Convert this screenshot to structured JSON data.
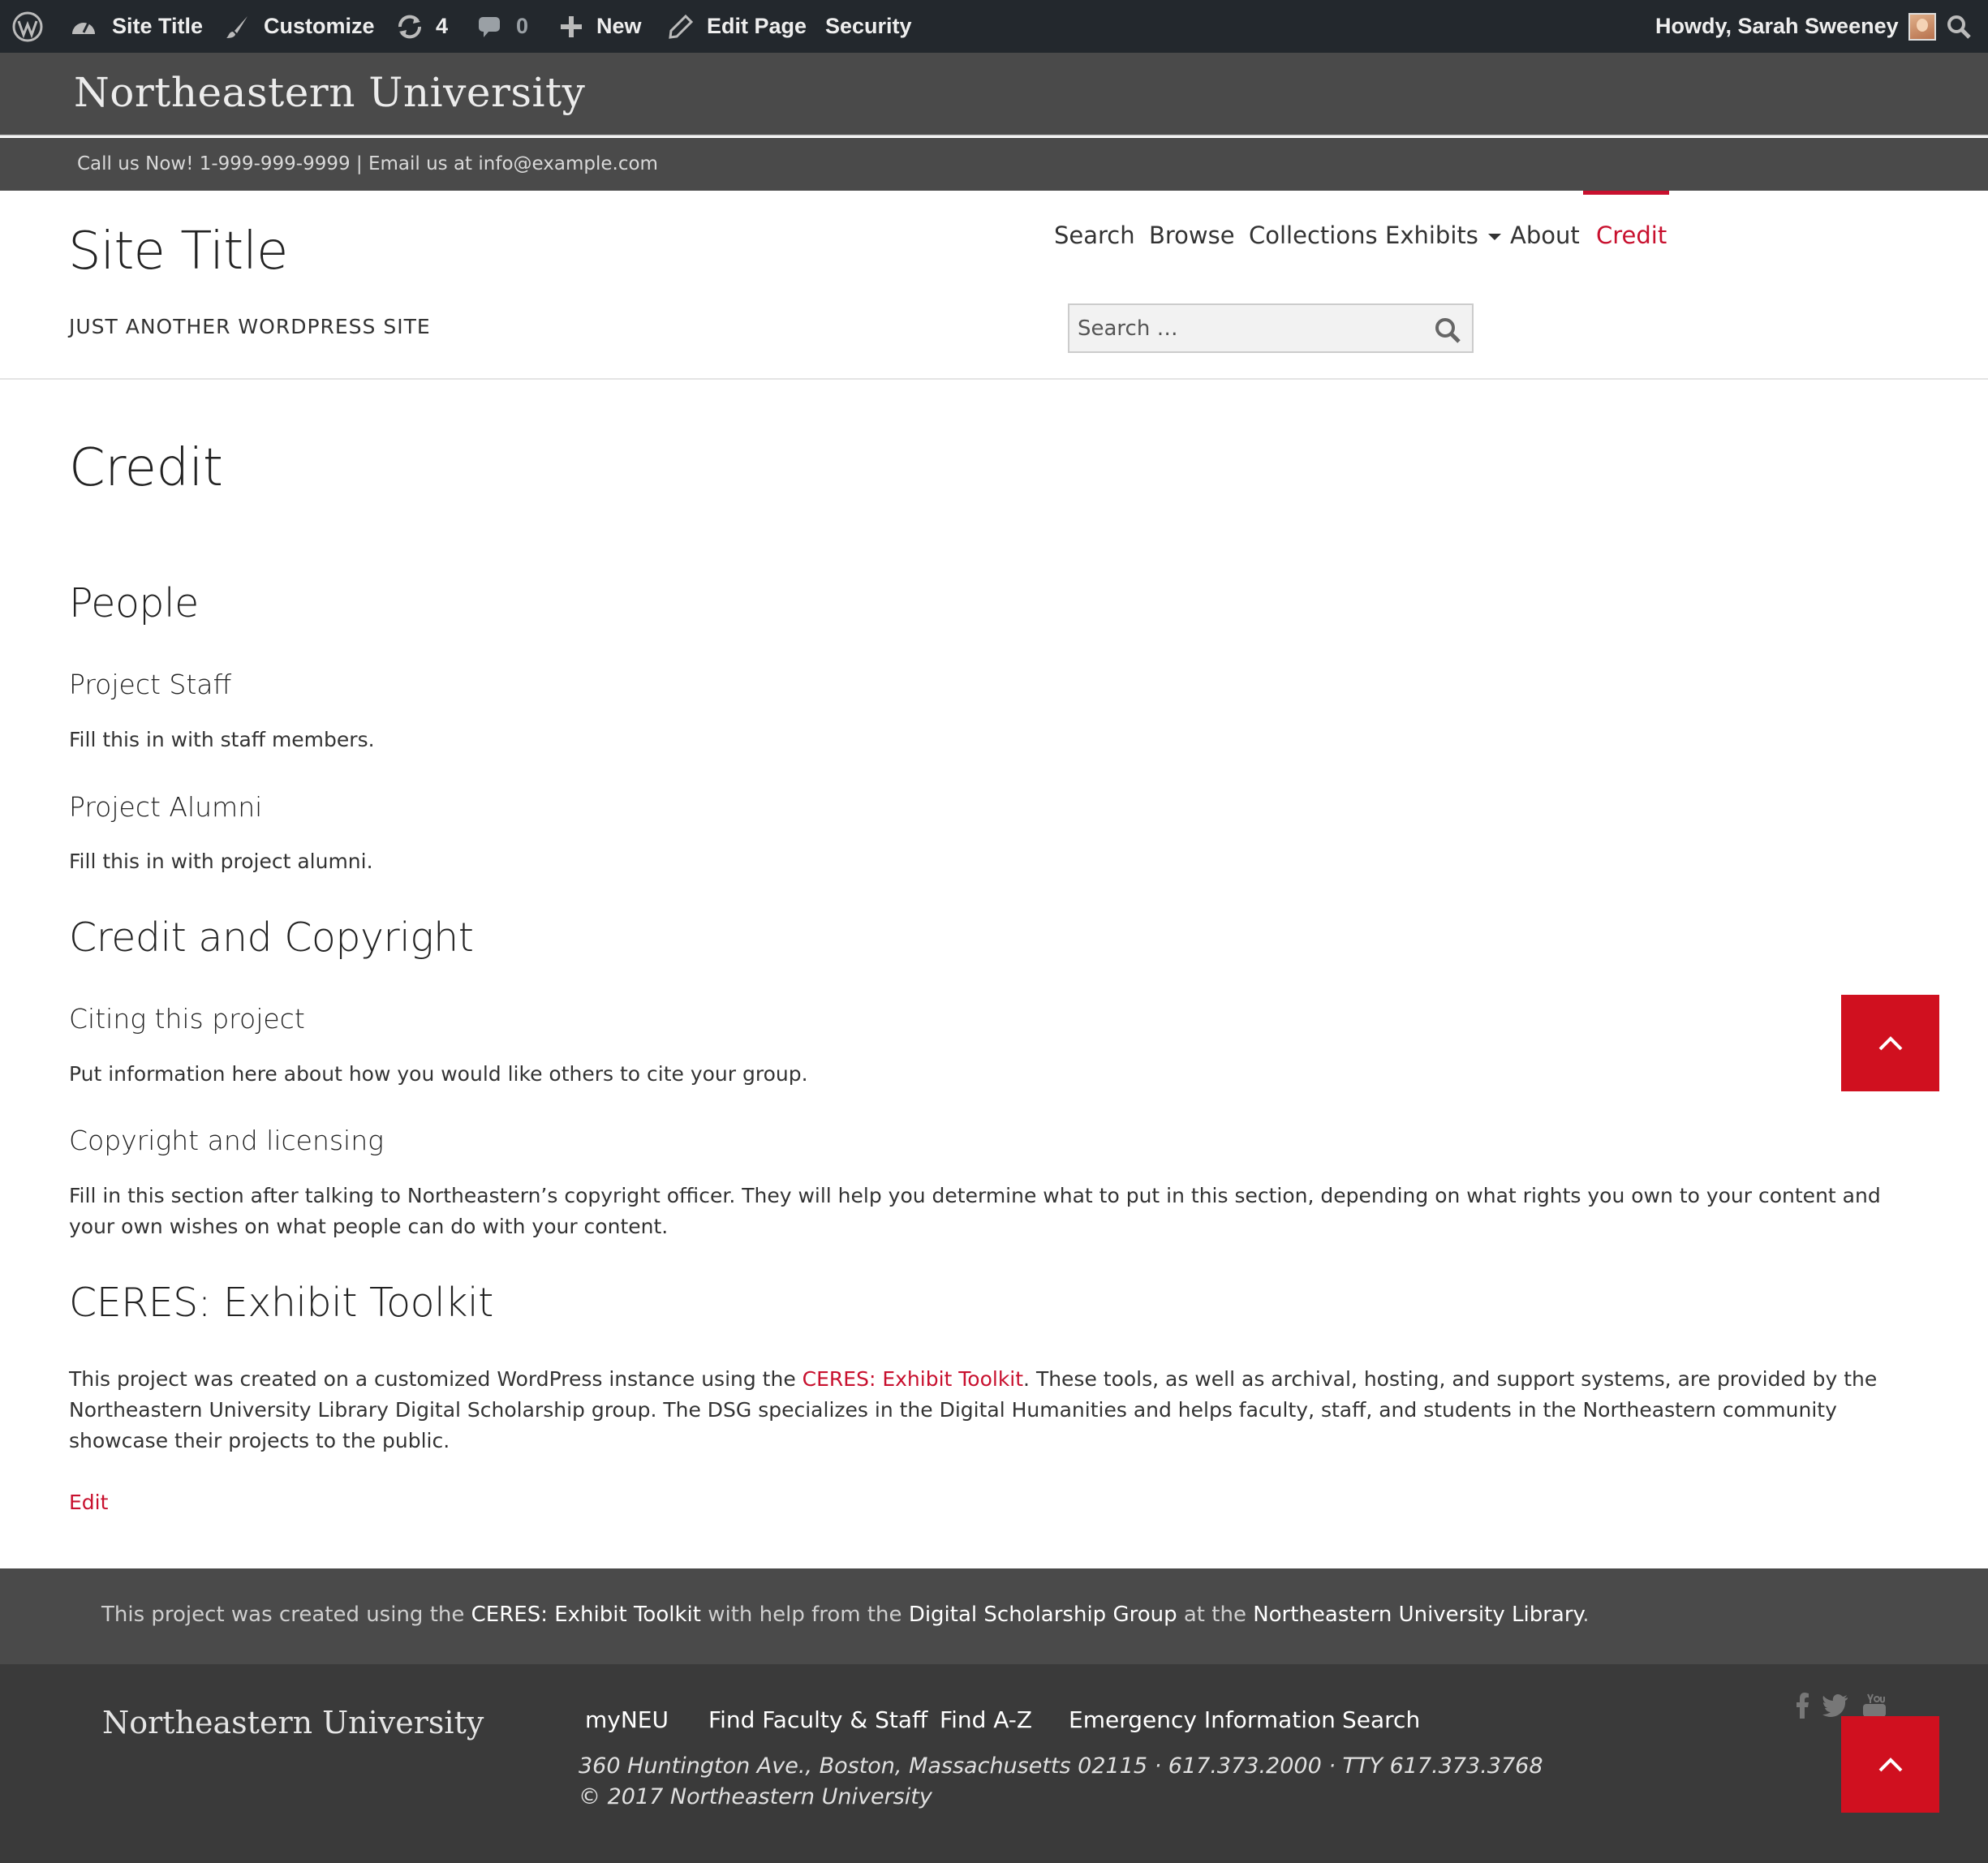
{
  "admin_bar": {
    "site_title": "Site Title",
    "customize": "Customize",
    "updates_count": "4",
    "comments_count": "0",
    "new": "New",
    "edit_page": "Edit Page",
    "security": "Security",
    "greeting": "Howdy, Sarah Sweeney"
  },
  "nu_header": {
    "logo_text": "Northeastern University",
    "contact": "Call us Now! 1-999-999-9999 | Email us at info@example.com"
  },
  "site": {
    "title": "Site Title",
    "tagline": "JUST ANOTHER WORDPRESS SITE"
  },
  "nav": {
    "items": [
      {
        "label": "Search"
      },
      {
        "label": "Browse"
      },
      {
        "label": "Collections"
      },
      {
        "label": "Exhibits"
      },
      {
        "label": "About"
      },
      {
        "label": "Credit"
      }
    ],
    "active": "Credit"
  },
  "search": {
    "placeholder": "Search …"
  },
  "page": {
    "title": "Credit",
    "people_heading": "People",
    "staff_heading": "Project Staff",
    "staff_text": "Fill this in with staff members.",
    "alumni_heading": "Project Alumni",
    "alumni_text": "Fill this in with project alumni.",
    "credit_heading": "Credit and Copyright",
    "citing_heading": "Citing this project",
    "citing_text": "Put information here about how you would like others to cite your group.",
    "copyright_heading": "Copyright and licensing",
    "copyright_text": "Fill in this section after talking to Northeastern’s copyright officer. They will help you determine what to put in this section, depending on what rights you own to your content and your own wishes on what people can do with your content.",
    "ceres_heading": "CERES: Exhibit Toolkit",
    "ceres_text_before": "This project was created on a customized WordPress instance using the ",
    "ceres_link": "CERES: Exhibit Toolkit",
    "ceres_text_after": ". These tools, as well as archival, hosting, and support systems, are provided by the Northeastern University Library Digital Scholarship group. The DSG specializes in the Digital Humanities and helps faculty, staff, and students in the Northeastern community showcase their projects to the public.",
    "edit": "Edit"
  },
  "credit_bar": {
    "t1": "This project was created using the ",
    "l1": "CERES: Exhibit Toolkit",
    "t2": " with help from the ",
    "l2": "Digital Scholarship Group",
    "t3": " at the ",
    "l3": "Northeastern University Library",
    "t4": "."
  },
  "footer": {
    "logo_text": "Northeastern University",
    "links": [
      {
        "label": "myNEU"
      },
      {
        "label": "Find Faculty & Staff"
      },
      {
        "label": "Find A-Z"
      },
      {
        "label": "Emergency Information"
      },
      {
        "label": "Search"
      }
    ],
    "address": "360 Huntington Ave., Boston, Massachusetts 02115 · 617.373.2000 · TTY 617.373.3768",
    "copyright": "© 2017 Northeastern University",
    "social": [
      "facebook-icon",
      "twitter-icon",
      "youtube-icon"
    ]
  },
  "colors": {
    "accent": "#c8102e",
    "admin_bar": "#23282d",
    "header_gray": "#4a4a4a",
    "footer_dark": "#3a3a3a",
    "to_top": "#d0101f"
  }
}
